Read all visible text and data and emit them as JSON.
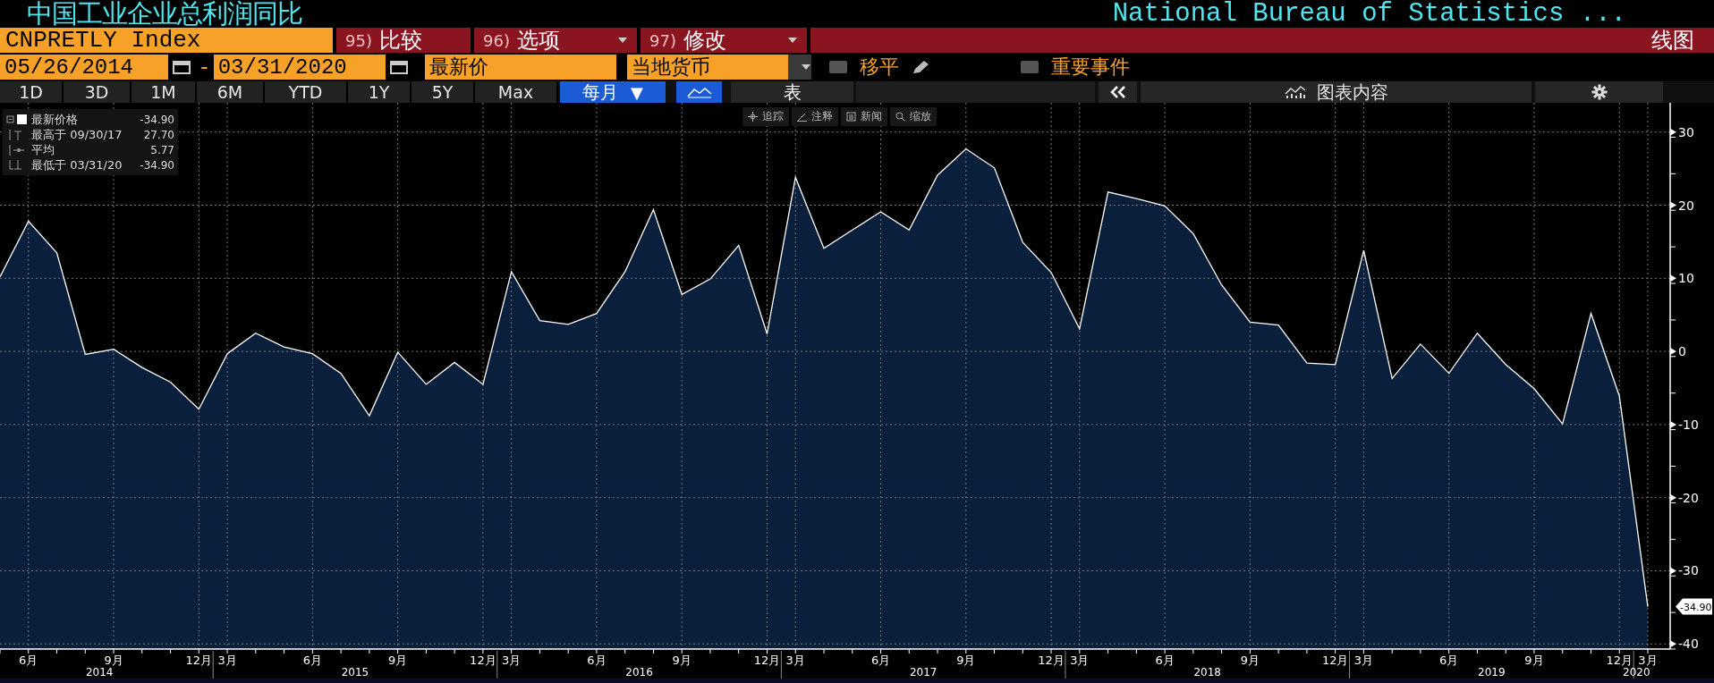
{
  "header": {
    "title": "中国工业企业总利润同比",
    "source": "National Bureau of Statistics ..."
  },
  "command_bar": {
    "ticker": "CNPRETLY Index",
    "view_label": "线图",
    "buttons": [
      {
        "number": "95)",
        "label": "比较",
        "dropdown": false
      },
      {
        "number": "96)",
        "label": "选项",
        "dropdown": true
      },
      {
        "number": "97)",
        "label": "修改",
        "dropdown": true
      }
    ]
  },
  "settings_bar": {
    "start_date": "05/26/2014",
    "separator": "-",
    "end_date": "03/31/2020",
    "price_field": "最新价",
    "currency_field": "当地货币",
    "options": [
      {
        "label": "移平",
        "checked": false,
        "kind": "edit"
      },
      {
        "label": "重要事件",
        "checked": false,
        "kind": "plain"
      }
    ]
  },
  "range_tabs": [
    {
      "label": "1D",
      "selected": false
    },
    {
      "label": "3D",
      "selected": false
    },
    {
      "label": "1M",
      "selected": false
    },
    {
      "label": "6M",
      "selected": false
    },
    {
      "label": "YTD",
      "selected": false
    },
    {
      "label": "1Y",
      "selected": false
    },
    {
      "label": "5Y",
      "selected": false
    },
    {
      "label": "Max",
      "selected": false
    }
  ],
  "period_button": {
    "label": "每月",
    "arrow": "▼"
  },
  "view_buttons": [
    {
      "kind": "chart",
      "selected": true
    },
    {
      "kind": "table",
      "label": "表",
      "selected": false
    }
  ],
  "chart_contents_button": {
    "label": "图表内容"
  },
  "chart_tools": [
    {
      "kind": "track",
      "label": "追踪"
    },
    {
      "kind": "annotate",
      "label": "注释"
    },
    {
      "kind": "news",
      "label": "新闻"
    },
    {
      "kind": "zoom",
      "label": "缩放"
    }
  ],
  "legend": [
    {
      "kind": "last",
      "label": "最新价格",
      "value": "-34.90"
    },
    {
      "kind": "high",
      "label": "最高于 09/30/17",
      "value": "27.70"
    },
    {
      "kind": "average",
      "label": "平均",
      "value": "5.77"
    },
    {
      "kind": "low",
      "label": "最低于 03/31/20",
      "value": "-34.90"
    }
  ],
  "chart": {
    "current_value": "-34.90",
    "years": [
      "2014",
      "2015",
      "2016",
      "2017",
      "2018",
      "2019",
      "2020"
    ],
    "chart_data": {
      "type": "area",
      "grid": true,
      "categories": [
        null,
        "6月",
        null,
        null,
        "9月",
        null,
        null,
        "12月",
        "3月",
        null,
        null,
        "6月",
        null,
        null,
        "9月",
        null,
        null,
        "12月",
        "3月",
        null,
        null,
        "6月",
        null,
        null,
        "9月",
        null,
        null,
        "12月",
        "3月",
        null,
        null,
        "6月",
        null,
        null,
        "9月",
        null,
        null,
        "12月",
        "3月",
        null,
        null,
        "6月",
        null,
        null,
        "9月",
        null,
        null,
        "12月",
        "3月",
        null,
        null,
        "6月",
        null,
        null,
        "9月",
        null,
        null,
        "12月",
        "3月"
      ],
      "series": [
        {
          "color": "#ffffff",
          "values": [
            10.2,
            17.8,
            13.5,
            -0.4,
            0.3,
            -2.2,
            -4.2,
            -7.9,
            -0.3,
            2.5,
            0.6,
            -0.3,
            -3.0,
            -8.8,
            -0.1,
            -4.5,
            -1.5,
            -4.5,
            10.9,
            4.2,
            3.7,
            5.2,
            10.9,
            19.4,
            7.8,
            9.9,
            14.5,
            2.4,
            23.8,
            14.1,
            16.6,
            19.1,
            16.6,
            24.1,
            27.7,
            25.1,
            14.9,
            10.8,
            3.1,
            21.8,
            20.9,
            19.9,
            16.1,
            9.1,
            4.0,
            3.6,
            -1.6,
            -1.8,
            13.8,
            -3.7,
            1.0,
            -3.0,
            2.5,
            -1.8,
            -5.1,
            -9.9,
            5.2,
            -6.1,
            -34.9
          ]
        }
      ],
      "ylim": [
        -40.7,
        34
      ],
      "yticks": [
        -40,
        -30,
        -20,
        -10,
        0,
        10,
        20,
        30
      ]
    }
  }
}
